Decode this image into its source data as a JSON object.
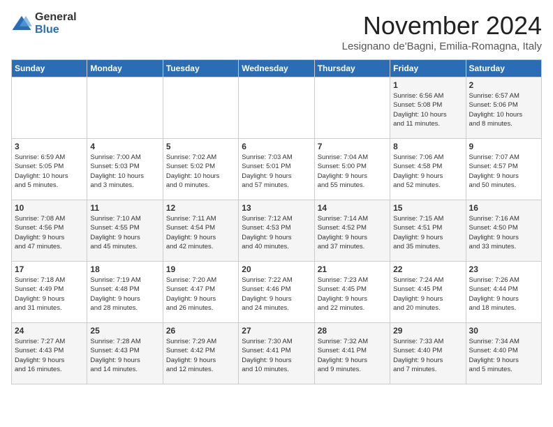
{
  "logo": {
    "general": "General",
    "blue": "Blue"
  },
  "header": {
    "month": "November 2024",
    "location": "Lesignano de'Bagni, Emilia-Romagna, Italy"
  },
  "weekdays": [
    "Sunday",
    "Monday",
    "Tuesday",
    "Wednesday",
    "Thursday",
    "Friday",
    "Saturday"
  ],
  "weeks": [
    [
      {
        "day": "",
        "info": ""
      },
      {
        "day": "",
        "info": ""
      },
      {
        "day": "",
        "info": ""
      },
      {
        "day": "",
        "info": ""
      },
      {
        "day": "",
        "info": ""
      },
      {
        "day": "1",
        "info": "Sunrise: 6:56 AM\nSunset: 5:08 PM\nDaylight: 10 hours\nand 11 minutes."
      },
      {
        "day": "2",
        "info": "Sunrise: 6:57 AM\nSunset: 5:06 PM\nDaylight: 10 hours\nand 8 minutes."
      }
    ],
    [
      {
        "day": "3",
        "info": "Sunrise: 6:59 AM\nSunset: 5:05 PM\nDaylight: 10 hours\nand 5 minutes."
      },
      {
        "day": "4",
        "info": "Sunrise: 7:00 AM\nSunset: 5:03 PM\nDaylight: 10 hours\nand 3 minutes."
      },
      {
        "day": "5",
        "info": "Sunrise: 7:02 AM\nSunset: 5:02 PM\nDaylight: 10 hours\nand 0 minutes."
      },
      {
        "day": "6",
        "info": "Sunrise: 7:03 AM\nSunset: 5:01 PM\nDaylight: 9 hours\nand 57 minutes."
      },
      {
        "day": "7",
        "info": "Sunrise: 7:04 AM\nSunset: 5:00 PM\nDaylight: 9 hours\nand 55 minutes."
      },
      {
        "day": "8",
        "info": "Sunrise: 7:06 AM\nSunset: 4:58 PM\nDaylight: 9 hours\nand 52 minutes."
      },
      {
        "day": "9",
        "info": "Sunrise: 7:07 AM\nSunset: 4:57 PM\nDaylight: 9 hours\nand 50 minutes."
      }
    ],
    [
      {
        "day": "10",
        "info": "Sunrise: 7:08 AM\nSunset: 4:56 PM\nDaylight: 9 hours\nand 47 minutes."
      },
      {
        "day": "11",
        "info": "Sunrise: 7:10 AM\nSunset: 4:55 PM\nDaylight: 9 hours\nand 45 minutes."
      },
      {
        "day": "12",
        "info": "Sunrise: 7:11 AM\nSunset: 4:54 PM\nDaylight: 9 hours\nand 42 minutes."
      },
      {
        "day": "13",
        "info": "Sunrise: 7:12 AM\nSunset: 4:53 PM\nDaylight: 9 hours\nand 40 minutes."
      },
      {
        "day": "14",
        "info": "Sunrise: 7:14 AM\nSunset: 4:52 PM\nDaylight: 9 hours\nand 37 minutes."
      },
      {
        "day": "15",
        "info": "Sunrise: 7:15 AM\nSunset: 4:51 PM\nDaylight: 9 hours\nand 35 minutes."
      },
      {
        "day": "16",
        "info": "Sunrise: 7:16 AM\nSunset: 4:50 PM\nDaylight: 9 hours\nand 33 minutes."
      }
    ],
    [
      {
        "day": "17",
        "info": "Sunrise: 7:18 AM\nSunset: 4:49 PM\nDaylight: 9 hours\nand 31 minutes."
      },
      {
        "day": "18",
        "info": "Sunrise: 7:19 AM\nSunset: 4:48 PM\nDaylight: 9 hours\nand 28 minutes."
      },
      {
        "day": "19",
        "info": "Sunrise: 7:20 AM\nSunset: 4:47 PM\nDaylight: 9 hours\nand 26 minutes."
      },
      {
        "day": "20",
        "info": "Sunrise: 7:22 AM\nSunset: 4:46 PM\nDaylight: 9 hours\nand 24 minutes."
      },
      {
        "day": "21",
        "info": "Sunrise: 7:23 AM\nSunset: 4:45 PM\nDaylight: 9 hours\nand 22 minutes."
      },
      {
        "day": "22",
        "info": "Sunrise: 7:24 AM\nSunset: 4:45 PM\nDaylight: 9 hours\nand 20 minutes."
      },
      {
        "day": "23",
        "info": "Sunrise: 7:26 AM\nSunset: 4:44 PM\nDaylight: 9 hours\nand 18 minutes."
      }
    ],
    [
      {
        "day": "24",
        "info": "Sunrise: 7:27 AM\nSunset: 4:43 PM\nDaylight: 9 hours\nand 16 minutes."
      },
      {
        "day": "25",
        "info": "Sunrise: 7:28 AM\nSunset: 4:43 PM\nDaylight: 9 hours\nand 14 minutes."
      },
      {
        "day": "26",
        "info": "Sunrise: 7:29 AM\nSunset: 4:42 PM\nDaylight: 9 hours\nand 12 minutes."
      },
      {
        "day": "27",
        "info": "Sunrise: 7:30 AM\nSunset: 4:41 PM\nDaylight: 9 hours\nand 10 minutes."
      },
      {
        "day": "28",
        "info": "Sunrise: 7:32 AM\nSunset: 4:41 PM\nDaylight: 9 hours\nand 9 minutes."
      },
      {
        "day": "29",
        "info": "Sunrise: 7:33 AM\nSunset: 4:40 PM\nDaylight: 9 hours\nand 7 minutes."
      },
      {
        "day": "30",
        "info": "Sunrise: 7:34 AM\nSunset: 4:40 PM\nDaylight: 9 hours\nand 5 minutes."
      }
    ]
  ]
}
